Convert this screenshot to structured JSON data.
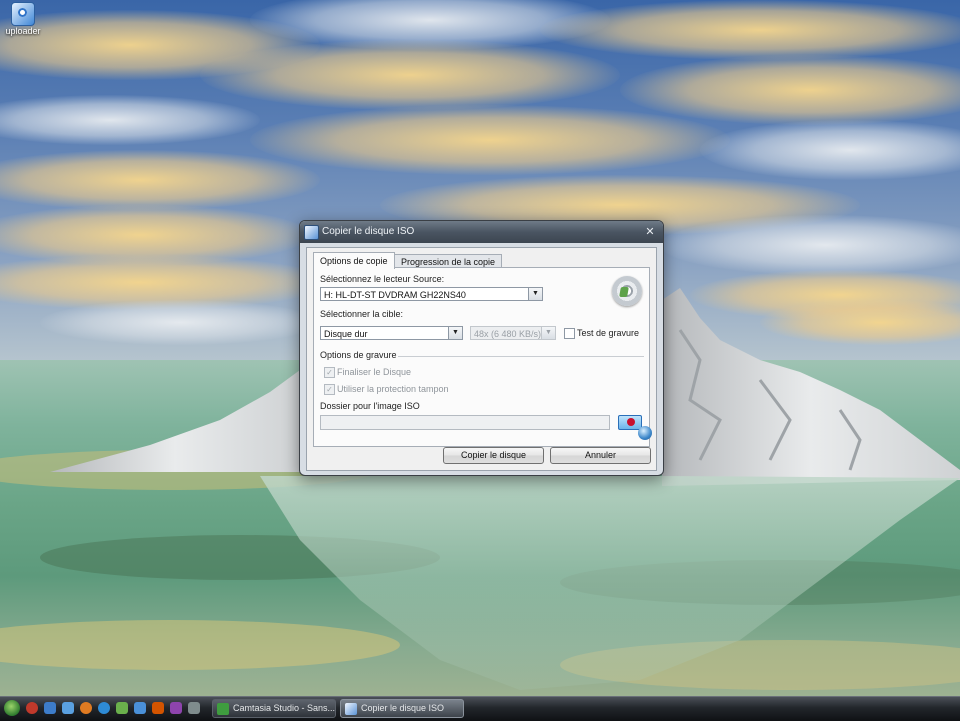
{
  "desktop": {
    "icon_label": "uploader"
  },
  "dialog": {
    "title": "Copier le disque ISO",
    "tabs": [
      {
        "label": "Options de copie",
        "active": true
      },
      {
        "label": "Progression de la copie",
        "active": false
      }
    ],
    "source_label": "Sélectionnez le lecteur Source:",
    "source_value": "H: HL-DT-ST DVDRAM GH22NS40",
    "target_label": "Sélectionner la cible:",
    "target_value": "Disque dur",
    "speed_value": "48x (6 480 KB/s)",
    "test_burn_label": "Test de gravure",
    "burn_options_label": "Options de gravure",
    "finalize_label": "Finaliser le Disque",
    "finalize_checked": true,
    "buffer_label": "Utiliser la protection tampon",
    "buffer_checked": true,
    "iso_folder_label": "Dossier pour l'image ISO",
    "iso_folder_value": "",
    "copy_button": "Copier le disque",
    "cancel_button": "Annuler"
  },
  "taskbar": {
    "buttons": [
      {
        "label": "Camtasia Studio - Sans...",
        "active": false
      },
      {
        "label": "Copier le disque ISO",
        "active": true
      }
    ]
  },
  "colors": {
    "titlebar": "#4a5562",
    "dialog_bg": "#f0f0f0",
    "taskbar": "#22262b"
  }
}
